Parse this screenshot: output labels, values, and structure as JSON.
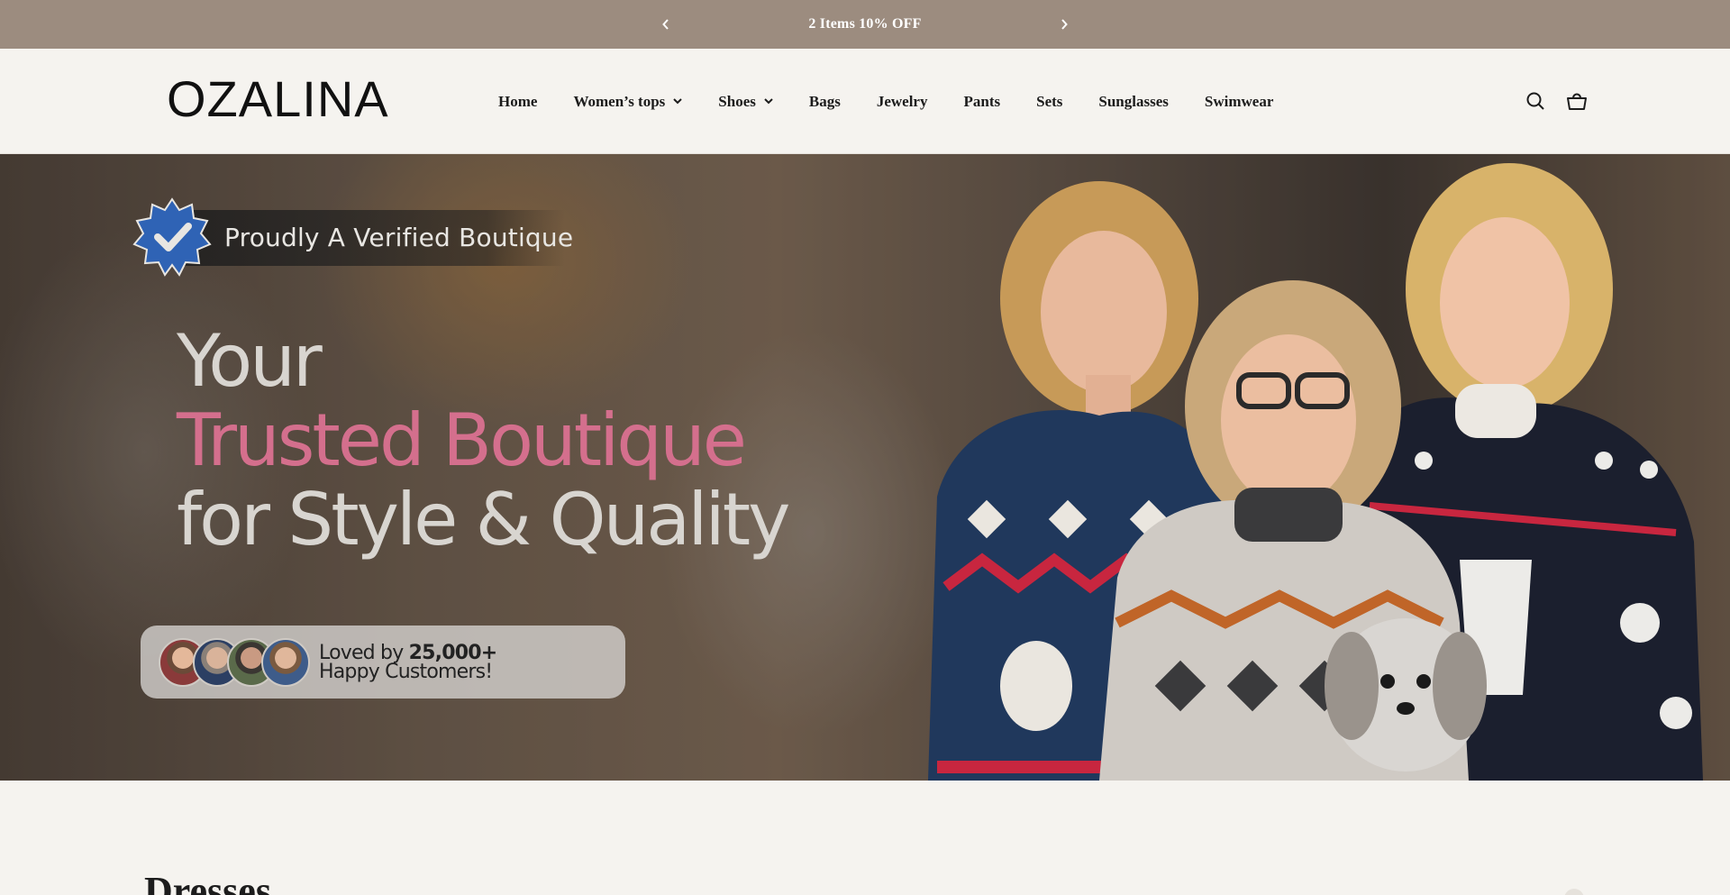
{
  "announcement": {
    "message": "2 Items 10% OFF",
    "prev_icon": "chevron-left-icon",
    "next_icon": "chevron-right-icon",
    "background": "#9c8c7f"
  },
  "header": {
    "logo": "OZALINA",
    "nav": [
      {
        "label": "Home",
        "dropdown": false
      },
      {
        "label": "Women’s tops",
        "dropdown": true
      },
      {
        "label": "Shoes",
        "dropdown": true
      },
      {
        "label": "Bags",
        "dropdown": false
      },
      {
        "label": "Jewelry",
        "dropdown": false
      },
      {
        "label": "Pants",
        "dropdown": false
      },
      {
        "label": "Sets",
        "dropdown": false
      },
      {
        "label": "Sunglasses",
        "dropdown": false
      },
      {
        "label": "Swimwear",
        "dropdown": false
      }
    ],
    "icons": [
      "search-icon",
      "cart-icon"
    ]
  },
  "hero": {
    "verified_text": "Proudly A Verified Boutique",
    "headline_line1": "Your",
    "headline_line2": "Trusted Boutique",
    "headline_line3": "for  Style & Quality",
    "loved_prefix": "Loved by ",
    "loved_count": "25,000+",
    "loved_suffix": "Happy Customers!",
    "accent_color": "#d46f8d",
    "badge_color": "#2f63b5"
  },
  "section": {
    "title": "Dresses"
  }
}
